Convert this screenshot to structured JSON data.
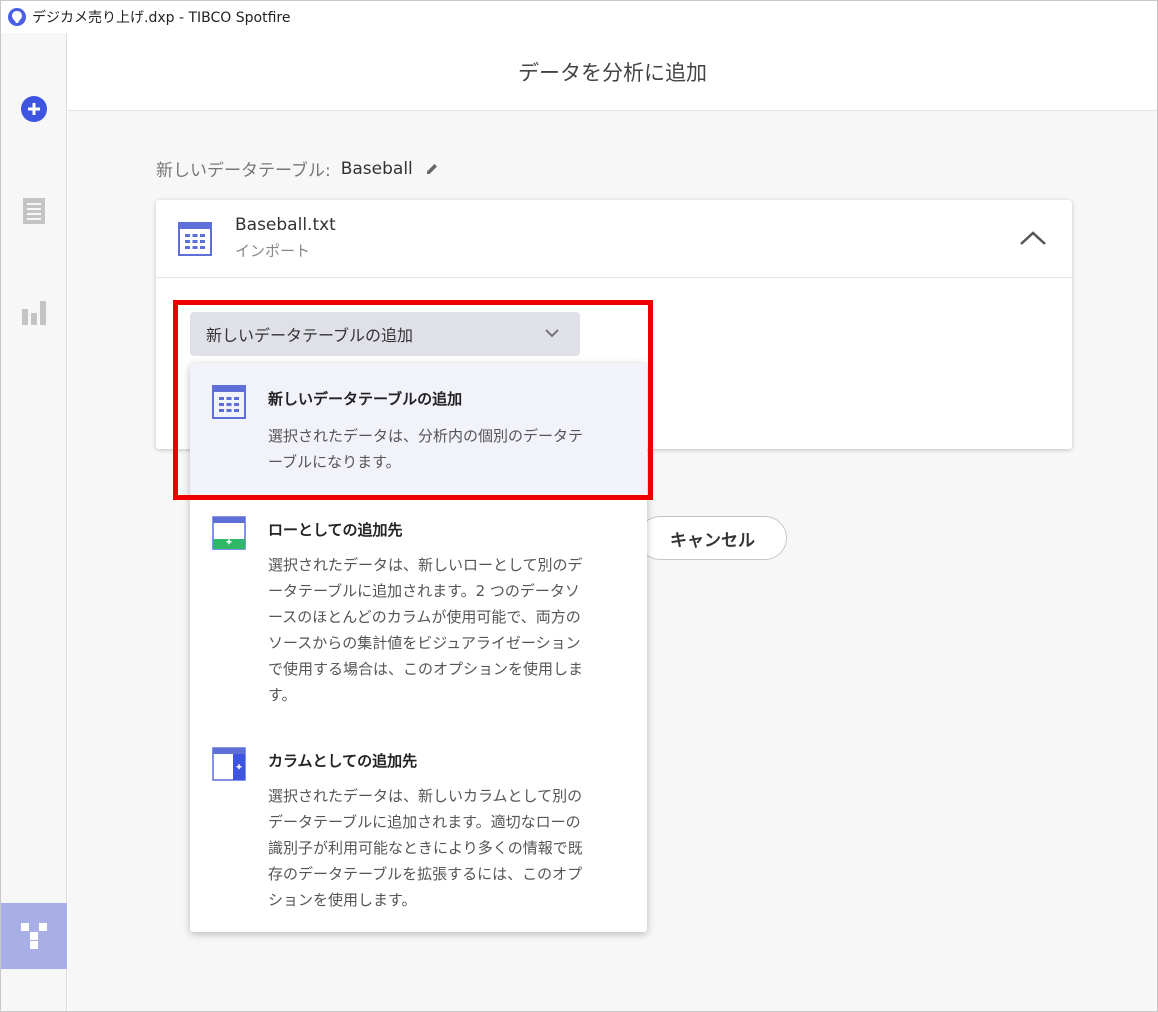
{
  "window": {
    "title": "デジカメ売り上げ.dxp - TIBCO Spotfire"
  },
  "sidebar": {
    "items": [
      {
        "icon": "add-circle-icon",
        "active": false
      },
      {
        "icon": "document-icon",
        "active": false
      },
      {
        "icon": "bar-chart-icon",
        "active": false
      },
      {
        "icon": "data-canvas-icon",
        "active": true
      }
    ]
  },
  "header": {
    "title": "データを分析に追加"
  },
  "data_table": {
    "prefix": "新しいデータテーブル:",
    "name": "Baseball"
  },
  "source_card": {
    "file_name": "Baseball.txt",
    "subtitle": "インポート"
  },
  "dropdown": {
    "selected": "新しいデータテーブルの追加"
  },
  "menu": {
    "items": [
      {
        "title": "新しいデータテーブルの追加",
        "desc_lines": [
          "選択されたデータは、分析内の個別のデータテ",
          "ーブルになります。"
        ],
        "icon": "table-icon",
        "selected": true
      },
      {
        "title": "ローとしての追加先",
        "desc_lines": [
          "選択されたデータは、新しいローとして別のデ",
          "ータテーブルに追加されます。2 つのデータソ",
          "ースのほとんどのカラムが使用可能で、両方の",
          "ソースからの集計値をビジュアライゼーション",
          "で使用する場合は、このオプションを使用しま",
          "す。"
        ],
        "icon": "add-rows-icon",
        "selected": false
      },
      {
        "title": "カラムとしての追加先",
        "desc_lines": [
          "選択されたデータは、新しいカラムとして別の",
          "データテーブルに追加されます。適切なローの",
          "識別子が利用可能なときにより多くの情報で既",
          "存のデータテーブルを拡張するには、このオプ",
          "ションを使用します。"
        ],
        "icon": "add-columns-icon",
        "selected": false
      }
    ]
  },
  "buttons": {
    "cancel": "キャンセル"
  },
  "colors": {
    "accent": "#3d55e0",
    "highlight": "#ee0000",
    "sidebar_active": "#a8aee6",
    "dropdown_bg": "#dfe0e8"
  }
}
